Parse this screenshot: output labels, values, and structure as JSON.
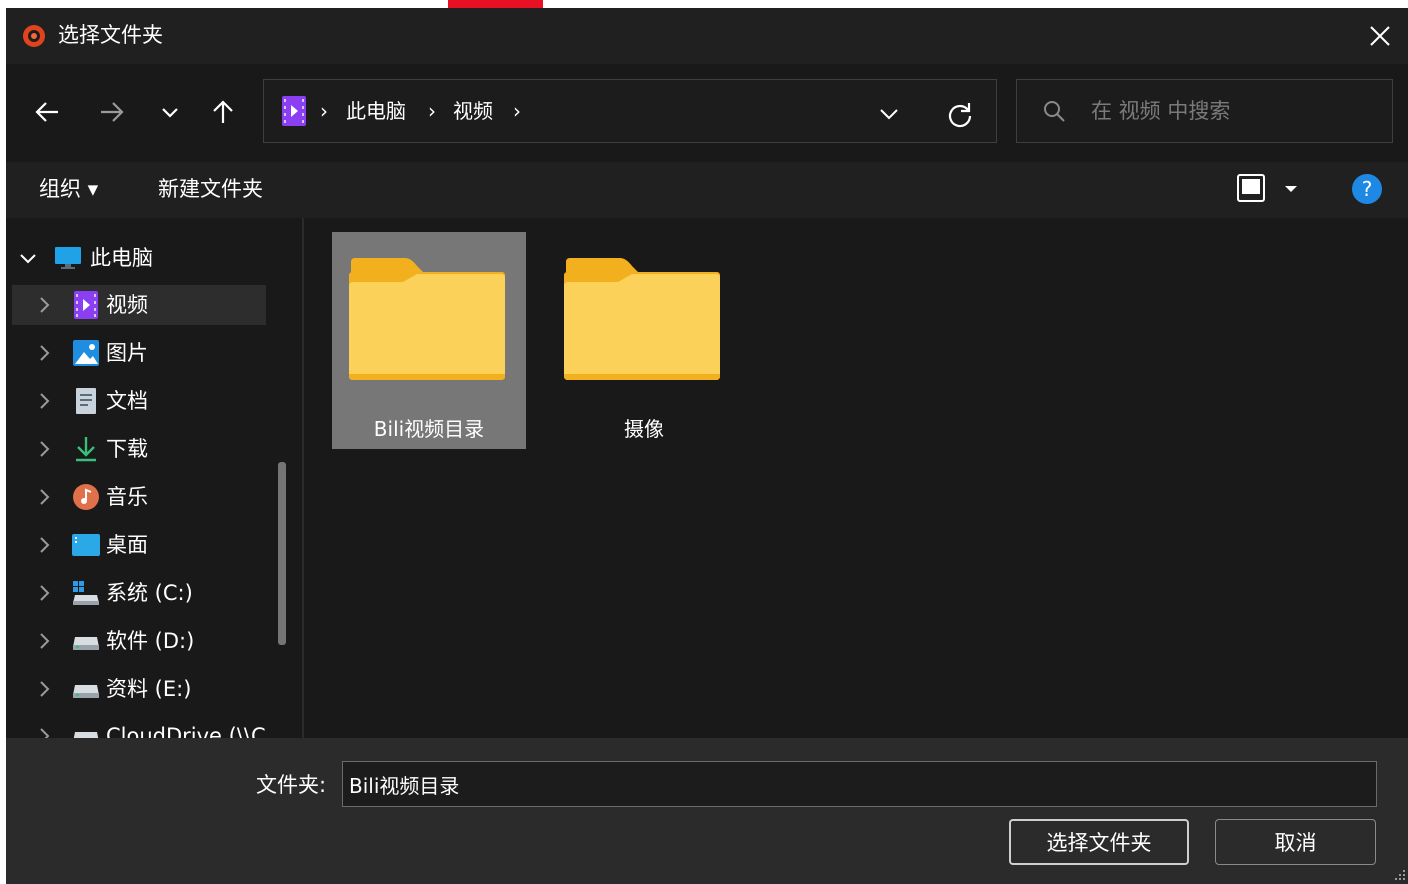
{
  "window": {
    "title": "选择文件夹"
  },
  "address": {
    "crumbs": [
      "此电脑",
      "视频"
    ],
    "separator": "›"
  },
  "search": {
    "placeholder": "在 视频 中搜索"
  },
  "toolbar": {
    "organize_label": "组织 ▾",
    "new_folder_label": "新建文件夹",
    "help_label": "?"
  },
  "sidebar": {
    "items": [
      {
        "label": "此电脑",
        "icon": "computer-icon",
        "expanded": true
      },
      {
        "label": "视频",
        "icon": "videos-folder-icon",
        "selected": true
      },
      {
        "label": "图片",
        "icon": "pictures-folder-icon"
      },
      {
        "label": "文档",
        "icon": "documents-icon"
      },
      {
        "label": "下载",
        "icon": "download-icon"
      },
      {
        "label": "音乐",
        "icon": "music-icon"
      },
      {
        "label": "桌面",
        "icon": "desktop-icon"
      },
      {
        "label": "系统 (C:)",
        "icon": "system-drive-icon"
      },
      {
        "label": "软件 (D:)",
        "icon": "drive-icon"
      },
      {
        "label": "资料 (E:)",
        "icon": "drive-icon"
      },
      {
        "label": "CloudDrive (\\\\C",
        "icon": "drive-icon"
      }
    ]
  },
  "content": {
    "items": [
      {
        "label": "Bili视频目录",
        "icon": "folder-icon",
        "selected": true
      },
      {
        "label": "摄像",
        "icon": "folder-icon",
        "selected": false
      }
    ]
  },
  "footer": {
    "folder_label": "文件夹:",
    "folder_value": "Bili视频目录",
    "select_button": "选择文件夹",
    "cancel_button": "取消"
  },
  "colors": {
    "background": "#191919",
    "titlebar": "#202020",
    "footer": "#2b2b2b",
    "folder_yellow": "#fcd15a",
    "help_blue": "#1e88e5",
    "video_purple": "#8a3ff2",
    "brand_red": "#e81123"
  }
}
